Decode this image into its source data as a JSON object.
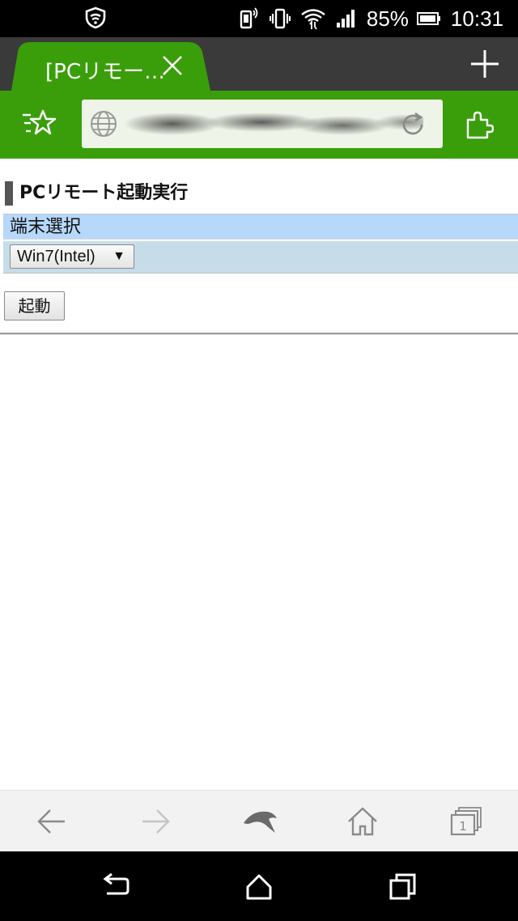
{
  "status_bar": {
    "battery_percent": "85%",
    "time": "10:31",
    "icons": [
      "shield-icon",
      "phone-notification-icon",
      "vibrate-icon",
      "wifi-icon",
      "signal-icon",
      "battery-icon"
    ]
  },
  "browser": {
    "tab": {
      "title": "[PCリモー…",
      "close_icon": "close-icon"
    },
    "new_tab_icon": "plus-icon",
    "bookmark_icon": "star-list-icon",
    "url_icon": "globe-icon",
    "reload_icon": "reload-icon",
    "extension_icon": "puzzle-icon",
    "colors": {
      "tab_green": "#3a9e0b",
      "tabbar_dark": "#3a3a3a"
    }
  },
  "page": {
    "heading": "PCリモート起動実行",
    "section_label": "端末選択",
    "device_select": {
      "selected": "Win7(Intel)",
      "arrow": "▼"
    },
    "launch_button": "起動",
    "colors": {
      "section_bg": "#b6d8fb",
      "select_row_bg": "#c6dde9"
    }
  },
  "bottom_toolbar": {
    "icons": [
      "back-arrow-icon",
      "forward-arrow-icon",
      "dolphin-icon",
      "home-icon",
      "tabs-icon"
    ],
    "tab_count": "1"
  },
  "android_nav": {
    "icons": [
      "nav-back-icon",
      "nav-home-icon",
      "nav-recents-icon"
    ]
  }
}
